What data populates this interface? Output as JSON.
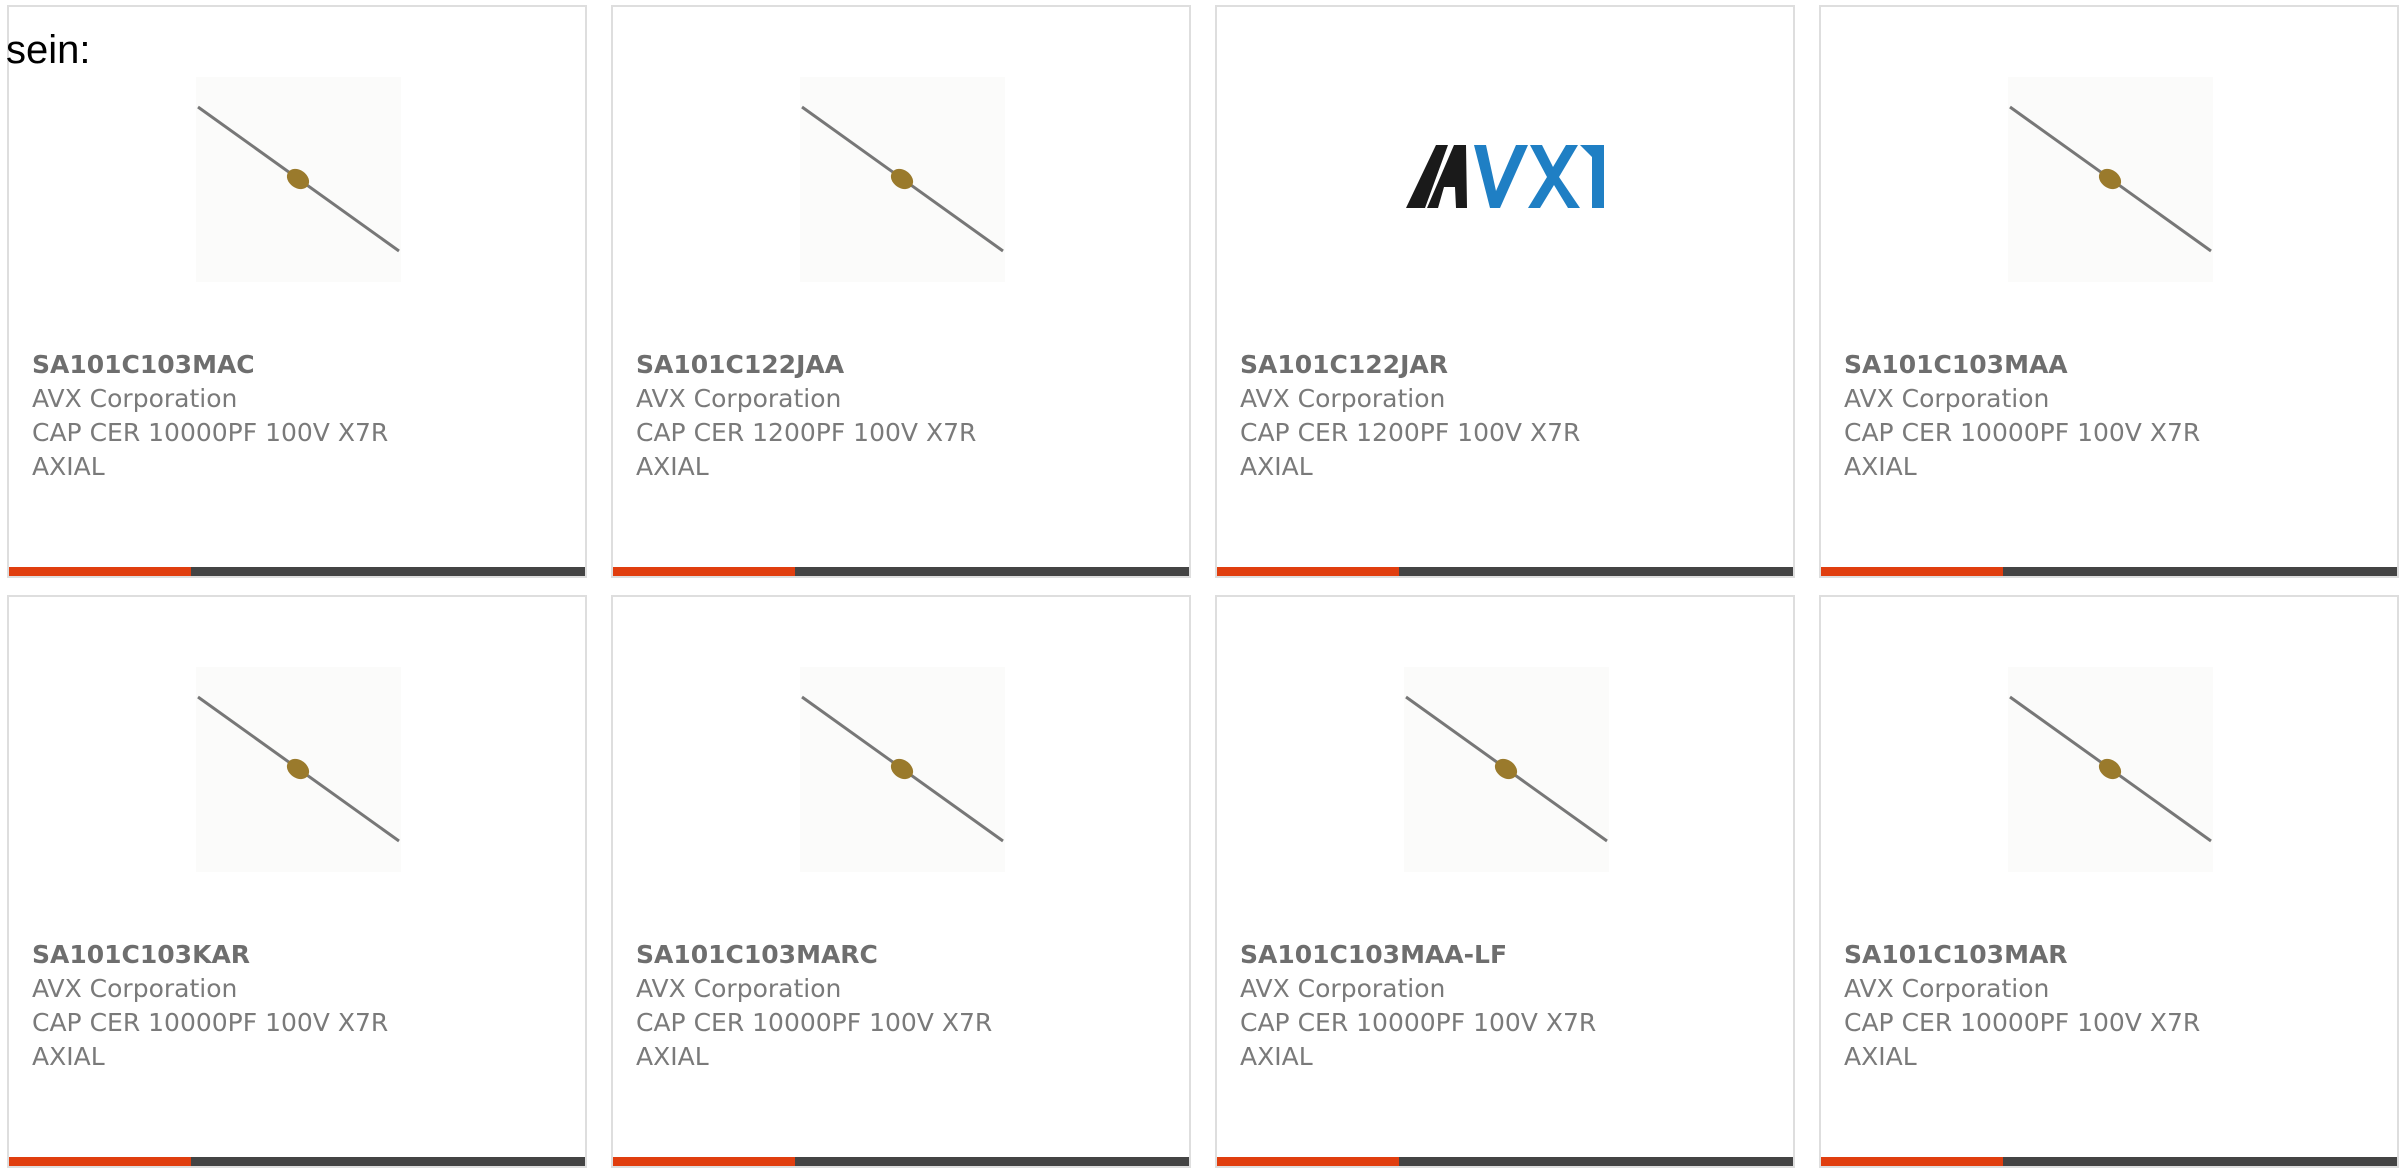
{
  "intro_text": "sein:",
  "colors": {
    "accent": "#e03e0f",
    "bar": "#444444",
    "border": "#dedede",
    "avx_black": "#1a1a1a",
    "avx_blue": "#1f7fc4"
  },
  "products": [
    {
      "part_number": "SA101C103MAC",
      "manufacturer": "AVX Corporation",
      "description": "CAP CER 10000PF 100V X7R AXIAL",
      "image": "capacitor-icon"
    },
    {
      "part_number": "SA101C122JAA",
      "manufacturer": "AVX Corporation",
      "description": "CAP CER 1200PF 100V X7R AXIAL",
      "image": "capacitor-icon"
    },
    {
      "part_number": "SA101C122JAR",
      "manufacturer": "AVX Corporation",
      "description": "CAP CER 1200PF 100V X7R AXIAL",
      "image": "avx-logo"
    },
    {
      "part_number": "SA101C103MAA",
      "manufacturer": "AVX Corporation",
      "description": "CAP CER 10000PF 100V X7R AXIAL",
      "image": "capacitor-icon"
    },
    {
      "part_number": "SA101C103KAR",
      "manufacturer": "AVX Corporation",
      "description": "CAP CER 10000PF 100V X7R AXIAL",
      "image": "capacitor-icon"
    },
    {
      "part_number": "SA101C103MARC",
      "manufacturer": "AVX Corporation",
      "description": "CAP CER 10000PF 100V X7R AXIAL",
      "image": "capacitor-icon"
    },
    {
      "part_number": "SA101C103MAA-LF",
      "manufacturer": "AVX Corporation",
      "description": "CAP CER 10000PF 100V X7R AXIAL",
      "image": "capacitor-icon"
    },
    {
      "part_number": "SA101C103MAR",
      "manufacturer": "AVX Corporation",
      "description": "CAP CER 10000PF 100V X7R AXIAL",
      "image": "capacitor-icon"
    }
  ]
}
